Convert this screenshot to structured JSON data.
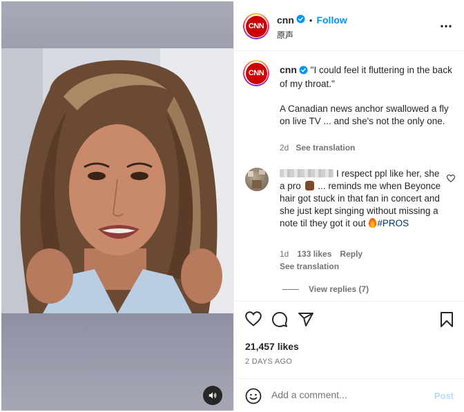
{
  "header": {
    "username": "cnn",
    "follow_label": "Follow",
    "dot": "•",
    "audio_label": "原声"
  },
  "caption": {
    "username": "cnn",
    "text_line1": "\"I could feel it fluttering in the back of my throat.\"",
    "text_line2": "A Canadian news anchor swallowed a fly on live TV ... and she's not the only one.",
    "age": "2d",
    "see_translation": "See translation"
  },
  "comment": {
    "text_part1": "I respect ppl like her, she a pro",
    "text_part2": "... reminds me when Beyonce hair got stuck in that fan in concert and she just kept singing without missing a note til they got it out",
    "hashtag": "#PROS",
    "age": "1d",
    "likes": "133 likes",
    "reply_label": "Reply",
    "see_translation": "See translation",
    "view_replies": "View replies (7)"
  },
  "actions": {
    "likes": "21,457 likes",
    "date": "2 DAYS AGO"
  },
  "add_comment": {
    "placeholder": "Add a comment...",
    "post_label": "Post"
  },
  "colors": {
    "link_blue": "#0095f6",
    "post_disabled": "#b3dbff",
    "cnn_red": "#cc0000",
    "secondary_text": "#737373"
  },
  "icons": {
    "verified": "verified-badge-icon",
    "more": "more-options-icon",
    "like": "heart-icon",
    "comment": "comment-icon",
    "share": "share-icon",
    "save": "bookmark-icon",
    "emoji": "emoji-icon",
    "sound": "speaker-icon"
  }
}
